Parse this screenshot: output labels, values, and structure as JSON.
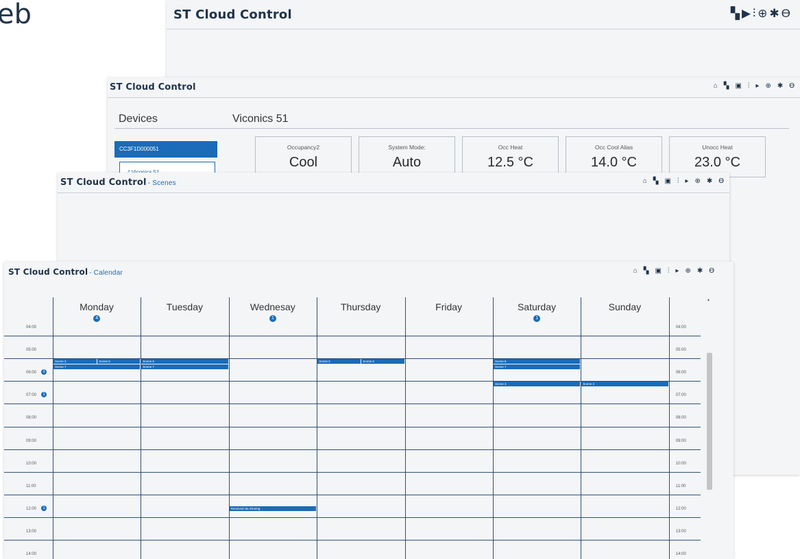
{
  "backdrop_text": "eb",
  "windows": {
    "w1": {
      "title": "ST Cloud Control"
    },
    "w2": {
      "title": "ST Cloud Control",
      "devices_heading": "Devices",
      "selected_device": "CC3F1D000051",
      "sub_device": "Viconics 51",
      "detail_heading": "Viconics 51",
      "tiles": [
        {
          "label": "Occupancy2",
          "value": "Cool"
        },
        {
          "label": "System Mode:",
          "value": "Auto"
        },
        {
          "label": "Occ Heat",
          "value": "12.5 °C"
        },
        {
          "label": "Occ Cool Alias",
          "value": "14.0 °C"
        },
        {
          "label": "Unocc Heat",
          "value": "23.0 °C"
        }
      ]
    },
    "w3": {
      "title": "ST Cloud Control",
      "subtitle": "- Scenes"
    },
    "w4": {
      "title": "ST Cloud Control",
      "subtitle": "- Calendar"
    }
  },
  "calendar": {
    "days": [
      {
        "name": "Monday",
        "badge": "4"
      },
      {
        "name": "Tuesday",
        "badge": ""
      },
      {
        "name": "Wednesay",
        "badge": "1"
      },
      {
        "name": "Thursday",
        "badge": ""
      },
      {
        "name": "Friday",
        "badge": ""
      },
      {
        "name": "Saturday",
        "badge": "1"
      },
      {
        "name": "Sunday",
        "badge": ""
      }
    ],
    "hours": [
      "04:00",
      "05:00",
      "06:00",
      "07:00",
      "08:00",
      "09:00",
      "10:00",
      "11:00",
      "12:00",
      "13:00",
      "14:00"
    ],
    "hour_badges": {
      "06:00": "3",
      "07:00": "1",
      "12:00": "1"
    },
    "events": [
      {
        "day": 0,
        "hour": "06:00",
        "row": 0,
        "half": "left",
        "label": "Scene 3"
      },
      {
        "day": 0,
        "hour": "06:00",
        "row": 0,
        "half": "right",
        "label": "Scene 6"
      },
      {
        "day": 0,
        "hour": "06:00",
        "row": 1,
        "half": "full",
        "label": "Scene 7"
      },
      {
        "day": 1,
        "hour": "06:00",
        "row": 0,
        "half": "full",
        "label": "Scene 6"
      },
      {
        "day": 1,
        "hour": "06:00",
        "row": 1,
        "half": "full",
        "label": "Scene 7"
      },
      {
        "day": 3,
        "hour": "06:00",
        "row": 0,
        "half": "left",
        "label": "Scene 5"
      },
      {
        "day": 3,
        "hour": "06:00",
        "row": 0,
        "half": "right",
        "label": "Scene 6"
      },
      {
        "day": 5,
        "hour": "06:00",
        "row": 0,
        "half": "full",
        "label": "Scene 6"
      },
      {
        "day": 5,
        "hour": "06:00",
        "row": 1,
        "half": "full",
        "label": "Scene 7"
      },
      {
        "day": 5,
        "hour": "07:00",
        "row": 0,
        "half": "full",
        "label": "Scene 3"
      },
      {
        "day": 6,
        "hour": "07:00",
        "row": 0,
        "half": "full",
        "label": "Scene 3"
      },
      {
        "day": 2,
        "hour": "12:00",
        "row": 2,
        "half": "full",
        "label": "Received via Sharing"
      }
    ]
  },
  "icons": {
    "w1": [
      "dashboard-icon",
      "play-icon",
      "remote-icon",
      "add-icon",
      "gear-icon",
      "account-icon"
    ],
    "main": [
      "home-icon",
      "dashboard-icon",
      "calendar-icon",
      "remote-icon",
      "play-icon",
      "add-icon",
      "gear-icon",
      "account-icon"
    ]
  },
  "colors": {
    "accent": "#1a6bb8",
    "title": "#1f3349",
    "grid": "#2d4e78",
    "panel": "#f4f5f7"
  }
}
